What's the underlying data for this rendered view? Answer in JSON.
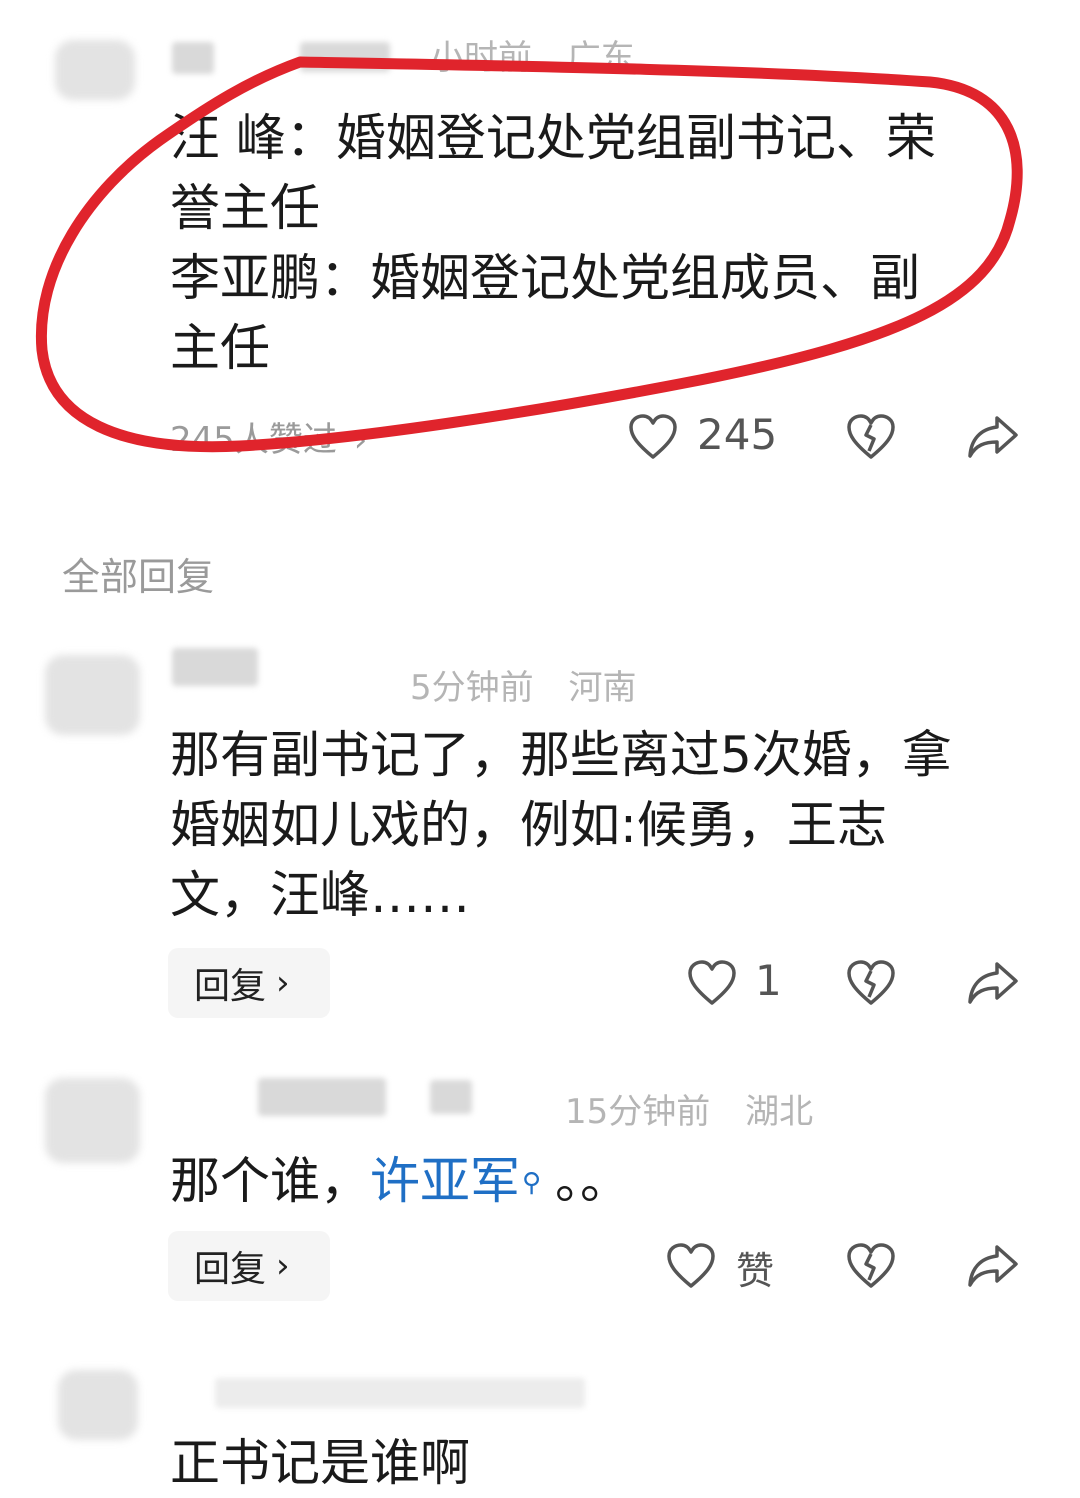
{
  "comments": [
    {
      "time": "小时前",
      "location": "广东",
      "lines": [
        "汪 峰：婚姻登记处党组副书记、荣",
        "誉主任",
        "李亚鹏：婚姻登记处党组成员、副",
        "主任"
      ],
      "likes_summary": "245人赞过",
      "like_count": "245"
    },
    {
      "time": "5分钟前",
      "location": "河南",
      "lines": [
        "那有副书记了，那些离过5次婚，拿",
        "婚姻如儿戏的，例如:候勇，王志",
        "文，汪峰……"
      ],
      "reply_label": "回复",
      "like_count": "1"
    },
    {
      "time": "15分钟前",
      "location": "湖北",
      "text_prefix": "那个谁，",
      "link_text": "许亚军",
      "text_suffix": "。。",
      "reply_label": "回复",
      "like_label": "赞"
    },
    {
      "text": "正书记是谁啊"
    }
  ],
  "section_title": "全部回复",
  "colors": {
    "highlight_circle": "#e0242c",
    "link": "#1f6fc5",
    "meta": "#b5b5b5"
  },
  "icons": [
    "heart-icon",
    "dislike-heart-icon",
    "share-icon",
    "search-icon"
  ]
}
